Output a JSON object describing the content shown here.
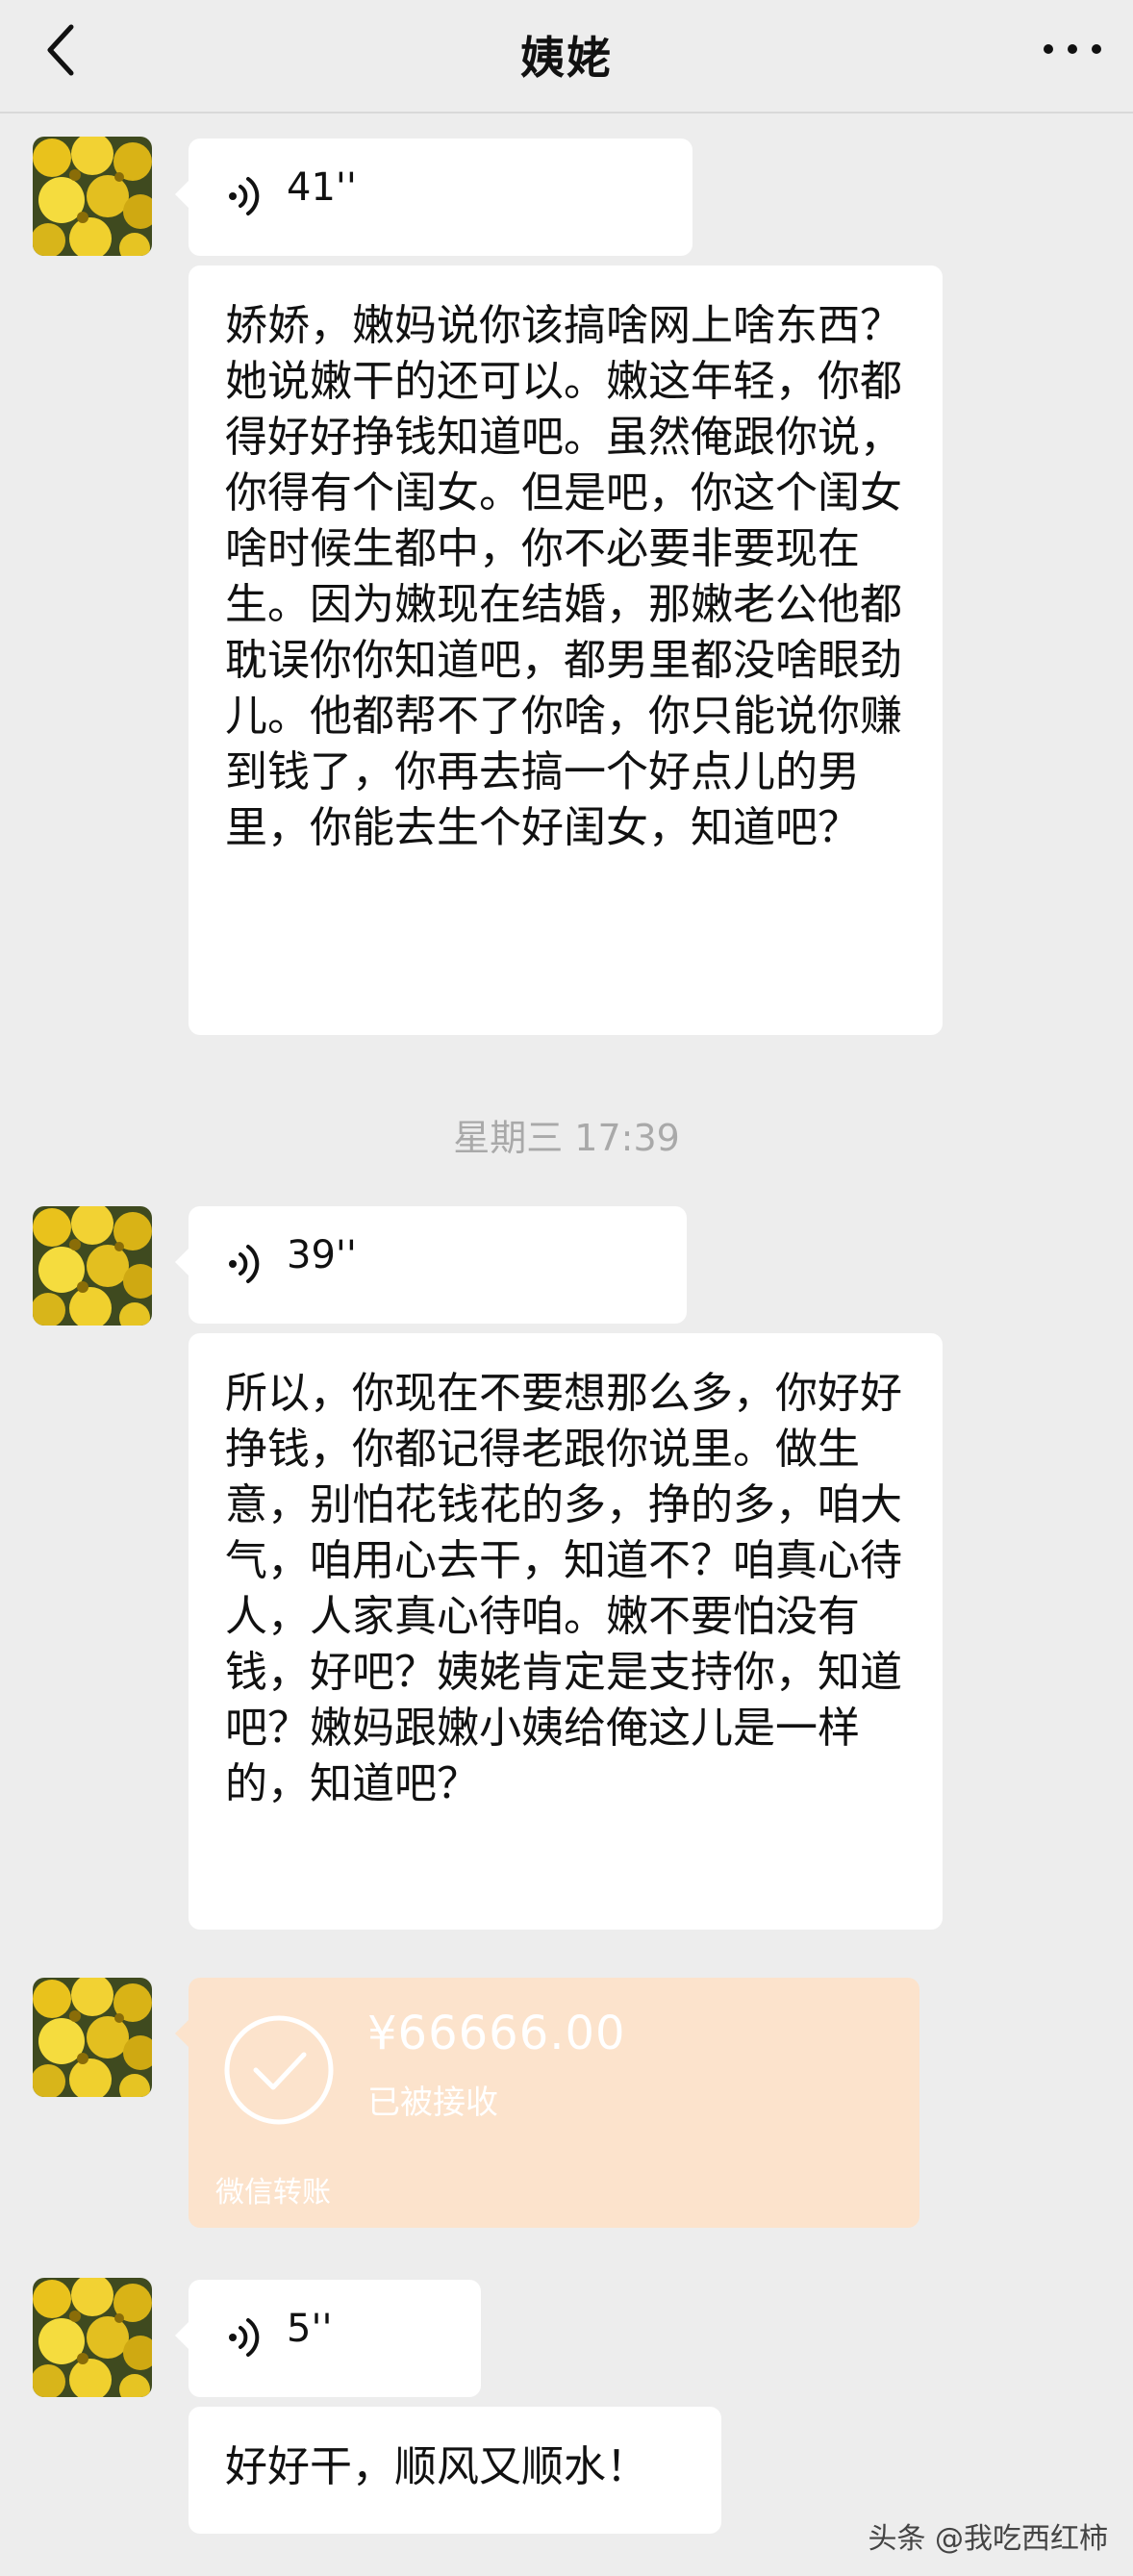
{
  "header": {
    "title": "姨姥"
  },
  "messages": {
    "voice1": {
      "duration": "41''"
    },
    "text1": {
      "content": "娇娇，嫩妈说你该搞啥网上啥东西？她说嫩干的还可以。嫩这年轻，你都得好好挣钱知道吧。虽然俺跟你说，你得有个闺女。但是吧，你这个闺女啥时候生都中，你不必要非要现在生。因为嫩现在结婚，那嫩老公他都耽误你你知道吧，都男里都没啥眼劲儿。他都帮不了你啥，你只能说你赚到钱了，你再去搞一个好点儿的男里，你能去生个好闺女，知道吧？"
    },
    "timestamp": "星期三 17:39",
    "voice2": {
      "duration": "39''"
    },
    "text2": {
      "content": "所以，你现在不要想那么多，你好好挣钱，你都记得老跟你说里。做生意，别怕花钱花的多，挣的多，咱大气，咱用心去干，知道不？咱真心待人，人家真心待咱。嫩不要怕没有钱，好吧？姨姥肯定是支持你，知道吧？嫩妈跟嫩小姨给俺这儿是一样的，知道吧？"
    },
    "transfer": {
      "amount": "¥66666.00",
      "status": "已被接收",
      "footer": "微信转账"
    },
    "voice3": {
      "duration": "5''"
    },
    "text3": {
      "content": "好好干，顺风又顺水！"
    }
  },
  "watermark": "头条 @我吃西红柿",
  "colors": {
    "background": "#ededed",
    "bubble": "#ffffff",
    "transfer": "#fce3cc",
    "timestamp": "#a9a9a9"
  }
}
